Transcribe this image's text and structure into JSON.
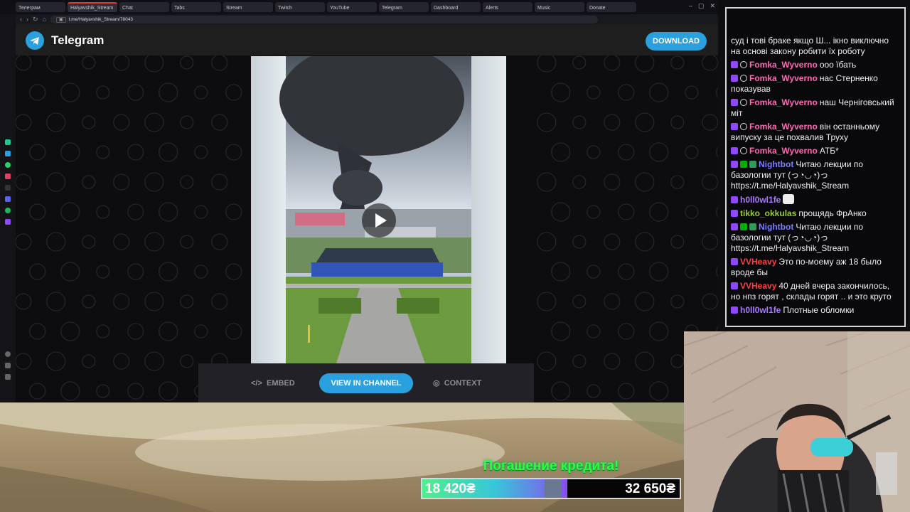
{
  "browser": {
    "tabs": [
      "Телеграм",
      "Halyavshik_Stream",
      "Chat",
      "Tabs",
      "Stream",
      "Twitch",
      "YouTube",
      "Telegram",
      "Dashboard",
      "Alerts",
      "Music",
      "Donate"
    ],
    "active_tab": "Halyavshik_Stream",
    "url": "t.me/Halyavshik_Stream/78043"
  },
  "telegram": {
    "brand": "Telegram",
    "download_label": "DOWNLOAD",
    "embed_label": "EMBED",
    "view_in_channel_label": "VIEW IN CHANNEL",
    "context_label": "CONTEXT",
    "accent": "#2aa1de"
  },
  "chat": {
    "messages": [
      {
        "user": "",
        "text": "суд і тові браке якщо Ш... ікно виключно на основі закону робити їх роботу",
        "color": "#efeff1",
        "badges": []
      },
      {
        "user": "Fomka_Wyverno",
        "text": "ооо їбать",
        "color": "#ff69b4",
        "badges": [
          "twitch",
          "o"
        ]
      },
      {
        "user": "Fomka_Wyverno",
        "text": "нас Стерненко показував",
        "color": "#ff69b4",
        "badges": [
          "twitch",
          "o"
        ]
      },
      {
        "user": "Fomka_Wyverno",
        "text": "наш Черніговський міт",
        "color": "#ff69b4",
        "badges": [
          "twitch",
          "o"
        ]
      },
      {
        "user": "Fomka_Wyverno",
        "text": "він останньому випуску за це похвалив Труху",
        "color": "#ff69b4",
        "badges": [
          "twitch",
          "o"
        ]
      },
      {
        "user": "Fomka_Wyverno",
        "text": "АТБ*",
        "color": "#ff69b4",
        "badges": [
          "twitch",
          "o"
        ]
      },
      {
        "user": "Nightbot",
        "text": "Читаю лекции по базологии тут (っ◔◡◔)っ https://t.me/Halyavshik_Stream",
        "color": "#7c7cff",
        "badges": [
          "twitch",
          "check",
          "robot"
        ]
      },
      {
        "user": "h0ll0wl1fe",
        "text": "",
        "color": "#a97cff",
        "badges": [
          "twitch"
        ],
        "emoji": true
      },
      {
        "user": "tikko_okkulas",
        "text": "прощядь ФрАнко",
        "color": "#9acd32",
        "badges": [
          "twitch"
        ]
      },
      {
        "user": "Nightbot",
        "text": "Читаю лекции по базологии тут (っ◔◡◔)っ https://t.me/Halyavshik_Stream",
        "color": "#7c7cff",
        "badges": [
          "twitch",
          "check",
          "robot"
        ]
      },
      {
        "user": "VVHeavy",
        "text": "Это по-моему аж 18 было вроде бы",
        "color": "#ff4040",
        "badges": [
          "twitch"
        ]
      },
      {
        "user": "VVHeavy",
        "text": "40 дней вчера закончилось, но нпз горят , склады горят .. и это круто",
        "color": "#ff4040",
        "badges": [
          "twitch"
        ]
      },
      {
        "user": "h0ll0wl1fe",
        "text": "Плотные обломки",
        "color": "#a97cff",
        "badges": [
          "twitch"
        ]
      }
    ]
  },
  "goal": {
    "title": "Погашение кредита!",
    "current": "18 420₴",
    "target": "32 650₴",
    "progress": 0.564
  }
}
